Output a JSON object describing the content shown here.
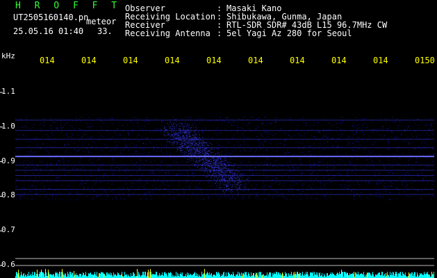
{
  "app": {
    "title": "H R O F F T"
  },
  "file": {
    "name": "UT2505160140.pn",
    "mode": "meteor",
    "datetime": "25.05.16 01:40",
    "count": "33."
  },
  "info": {
    "rows": [
      {
        "label": "Observer",
        "sep": ":",
        "value": "Masaki Kano"
      },
      {
        "label": "Receiving Location",
        "sep": ":",
        "value": "Shibukawa, Gunma, Japan"
      },
      {
        "label": "Receiver",
        "sep": ":",
        "value": "RTL-SDR SDR# 43dB L15 96.7MHz CW"
      },
      {
        "label": "Receiving Antenna",
        "sep": ":",
        "value": "5el Yagi Az 280 for Seoul"
      }
    ]
  },
  "chart_data": {
    "type": "heatmap",
    "ylabel": "kHz",
    "x_tick_labels": [
      "014",
      "014",
      "014",
      "014",
      "014",
      "014",
      "014",
      "014",
      "014",
      "0150"
    ],
    "y_tick_labels": [
      "1.1",
      "1.0",
      "0.9",
      "0.8",
      "0.7",
      "0.6"
    ],
    "ylim": [
      0.58,
      1.14
    ],
    "bands_khz": [
      1.02,
      0.99,
      0.965,
      0.94,
      0.915,
      0.89,
      0.875,
      0.86,
      0.845,
      0.82,
      0.805
    ],
    "main_band_khz": 0.915,
    "guide_lines_khz": [
      0.62,
      0.6
    ],
    "colors": {
      "noise": "#1a1aff",
      "band": "#3c3cff",
      "main_band": "#6a6aff",
      "guide": "#bbbbbb",
      "bottom_noise": "#00ffff",
      "bottom_spike": "#ffff00"
    }
  }
}
